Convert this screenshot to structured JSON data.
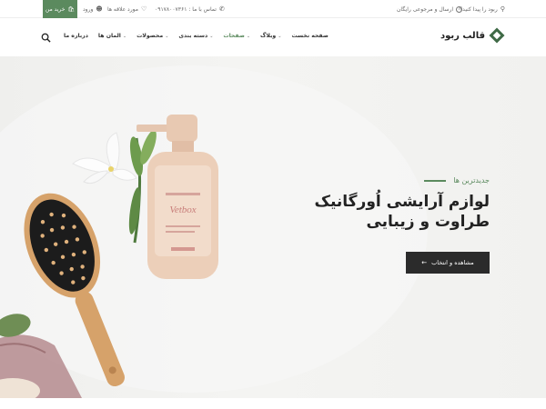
{
  "topbar": {
    "help_question": "ربود را پیدا کنید؟",
    "shipping": "ارسال و مرجوعی رایگان",
    "phone": "تماس با ما : ۰۹۱۷۸۰۰۷۳۶۱",
    "wishlist": "مورد علاقه ها",
    "login": "ورود",
    "cart": "خرید من"
  },
  "logo": {
    "text": "قالب ربود"
  },
  "nav": {
    "items": [
      {
        "label": "صفحه نخست",
        "dropdown": false
      },
      {
        "label": "وبلاگ",
        "dropdown": true
      },
      {
        "label": "صفحات",
        "dropdown": true,
        "active": true
      },
      {
        "label": "دسته بندی",
        "dropdown": true
      },
      {
        "label": "محصولات",
        "dropdown": true
      },
      {
        "label": "المان ها",
        "dropdown": true
      },
      {
        "label": "درباره ما",
        "dropdown": false
      }
    ]
  },
  "hero": {
    "kicker": "جدیدترین ها",
    "headline_line1": "لوازم آرایشی اُورگانیک",
    "headline_line2": "طراوت و زیبایی",
    "cta": "مشاهده و انتخاب",
    "bottle_label": "Vetbox"
  },
  "colors": {
    "accent": "#5b8a5e",
    "logo": "#3f6a46",
    "cta_bg": "#2b2b2b"
  }
}
